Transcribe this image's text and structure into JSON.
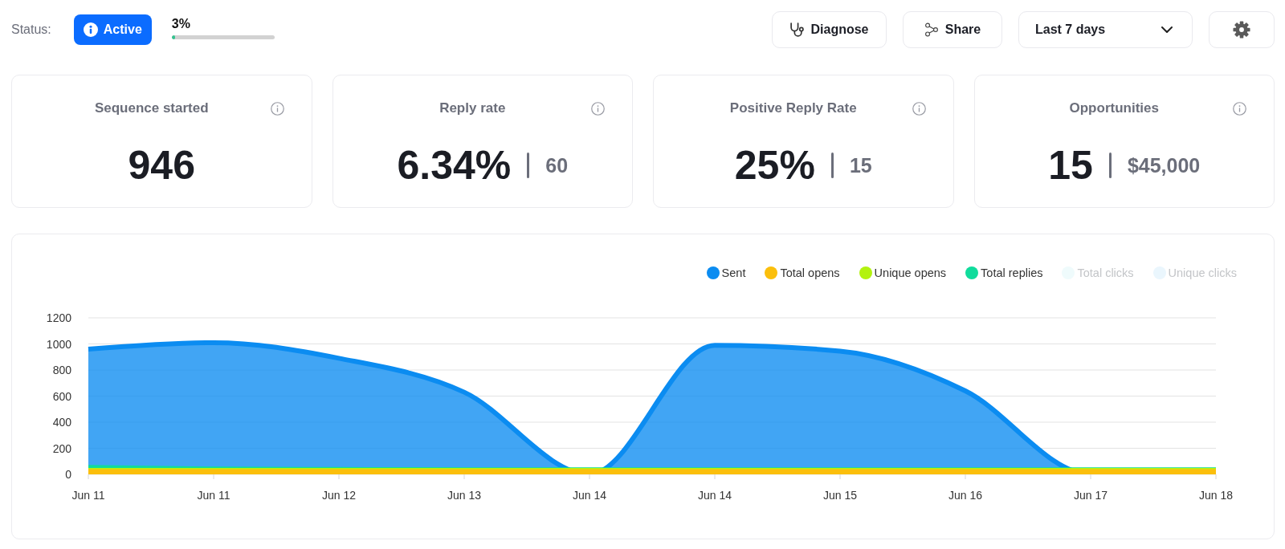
{
  "status": {
    "label": "Status:",
    "badge": "Active",
    "progress": {
      "reading": "3%",
      "level": 0.03
    }
  },
  "toolbar": {
    "diagnose_button": {
      "label": "Diagnose"
    },
    "share_button": {
      "label": "Share"
    },
    "date_range": {
      "value": "Last 7 days"
    }
  },
  "metrics": [
    {
      "title": "Sequence started",
      "value": "946"
    },
    {
      "title": "Reply rate",
      "value": "6.34%",
      "secondary": "60"
    },
    {
      "title": "Positive Reply Rate",
      "value": "25%",
      "secondary": "15"
    },
    {
      "title": "Opportunities",
      "value": "15",
      "secondary": "$45,000"
    }
  ],
  "chart": {
    "legend": [
      {
        "on": true
      },
      {
        "on": true
      },
      {
        "on": true
      },
      {
        "on": true
      },
      {
        "on": false
      },
      {
        "on": false
      }
    ],
    "chart_data": {
      "type": "area",
      "categories": [
        "Jun 11",
        "Jun 11",
        "Jun 12",
        "Jun 13",
        "Jun 14",
        "Jun 14",
        "Jun 15",
        "Jun 16",
        "Jun 17",
        "Jun 18"
      ],
      "series": [
        {
          "name": "Sent",
          "color": "#0b8cf1",
          "values": [
            960,
            1010,
            890,
            630,
            0,
            990,
            945,
            640,
            0,
            0
          ]
        },
        {
          "name": "Total opens",
          "color": "#fbbf0c",
          "values": [
            35,
            35,
            35,
            35,
            35,
            35,
            35,
            35,
            35,
            35
          ]
        },
        {
          "name": "Unique opens",
          "color": "#b3f20f",
          "values": [
            45,
            45,
            45,
            45,
            45,
            45,
            45,
            45,
            45,
            45
          ]
        },
        {
          "name": "Total replies",
          "color": "#10dc9c",
          "values": [
            68,
            55,
            52,
            50,
            50,
            50,
            50,
            50,
            50,
            50
          ]
        },
        {
          "name": "Total clicks",
          "color": "#effbfc",
          "values": [
            null,
            null,
            null,
            null,
            null,
            null,
            null,
            null,
            null,
            null
          ]
        },
        {
          "name": "Unique clicks",
          "color": "#eaf6fd",
          "values": [
            null,
            null,
            null,
            null,
            null,
            null,
            null,
            null,
            null,
            null
          ]
        }
      ],
      "ylim": [
        0,
        1200
      ],
      "yticks": [
        0,
        200,
        400,
        600,
        800,
        1000,
        1200
      ],
      "grid": true,
      "stacked": false
    }
  }
}
